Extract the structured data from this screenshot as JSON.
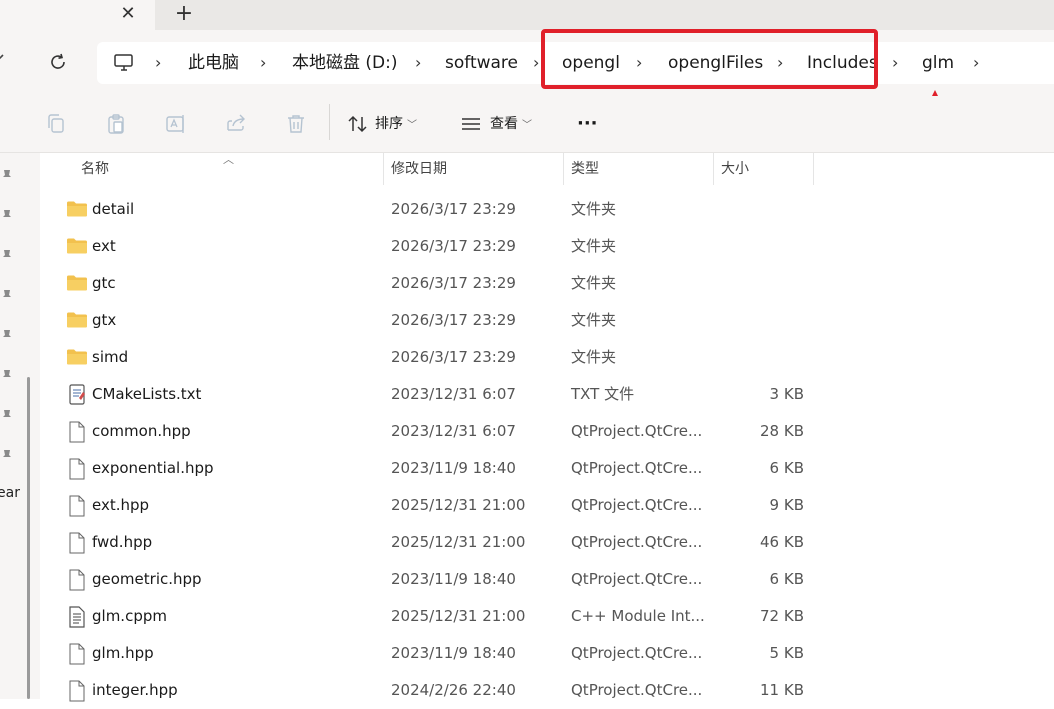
{
  "tabs": {
    "close_glyph": "✕",
    "new_glyph": "+"
  },
  "breadcrumb": {
    "items": [
      "此电脑",
      "本地磁盘 (D:)",
      "software",
      "opengl",
      "openglFiles",
      "Includes",
      "glm"
    ],
    "separator": "›"
  },
  "toolbar": {
    "sort_label": "排序",
    "view_label": "查看",
    "more_label": "···"
  },
  "left_pane": {
    "partial_text": "ear"
  },
  "columns": {
    "name": "名称",
    "date": "修改日期",
    "type": "类型",
    "size": "大小"
  },
  "files": [
    {
      "name": "detail",
      "date": "2026/3/17 23:29",
      "type": "文件夹",
      "size": "",
      "icon": "folder-icon"
    },
    {
      "name": "ext",
      "date": "2026/3/17 23:29",
      "type": "文件夹",
      "size": "",
      "icon": "folder-icon"
    },
    {
      "name": "gtc",
      "date": "2026/3/17 23:29",
      "type": "文件夹",
      "size": "",
      "icon": "folder-icon"
    },
    {
      "name": "gtx",
      "date": "2026/3/17 23:29",
      "type": "文件夹",
      "size": "",
      "icon": "folder-icon"
    },
    {
      "name": "simd",
      "date": "2026/3/17 23:29",
      "type": "文件夹",
      "size": "",
      "icon": "folder-icon"
    },
    {
      "name": "CMakeLists.txt",
      "date": "2023/12/31 6:07",
      "type": "TXT 文件",
      "size": "3 KB",
      "icon": "text-file-icon"
    },
    {
      "name": "common.hpp",
      "date": "2023/12/31 6:07",
      "type": "QtProject.QtCre...",
      "size": "28 KB",
      "icon": "file-icon"
    },
    {
      "name": "exponential.hpp",
      "date": "2023/11/9 18:40",
      "type": "QtProject.QtCre...",
      "size": "6 KB",
      "icon": "file-icon"
    },
    {
      "name": "ext.hpp",
      "date": "2025/12/31 21:00",
      "type": "QtProject.QtCre...",
      "size": "9 KB",
      "icon": "file-icon"
    },
    {
      "name": "fwd.hpp",
      "date": "2025/12/31 21:00",
      "type": "QtProject.QtCre...",
      "size": "46 KB",
      "icon": "file-icon"
    },
    {
      "name": "geometric.hpp",
      "date": "2023/11/9 18:40",
      "type": "QtProject.QtCre...",
      "size": "6 KB",
      "icon": "file-icon"
    },
    {
      "name": "glm.cppm",
      "date": "2025/12/31 21:00",
      "type": "C++ Module Int...",
      "size": "72 KB",
      "icon": "document-file-icon"
    },
    {
      "name": "glm.hpp",
      "date": "2023/11/9 18:40",
      "type": "QtProject.QtCre...",
      "size": "5 KB",
      "icon": "file-icon"
    },
    {
      "name": "integer.hpp",
      "date": "2024/2/26 22:40",
      "type": "QtProject.QtCre...",
      "size": "11 KB",
      "icon": "file-icon"
    }
  ],
  "colors": {
    "annotation_red": "#e0202a",
    "folder_yellow": "#f2c14e"
  }
}
